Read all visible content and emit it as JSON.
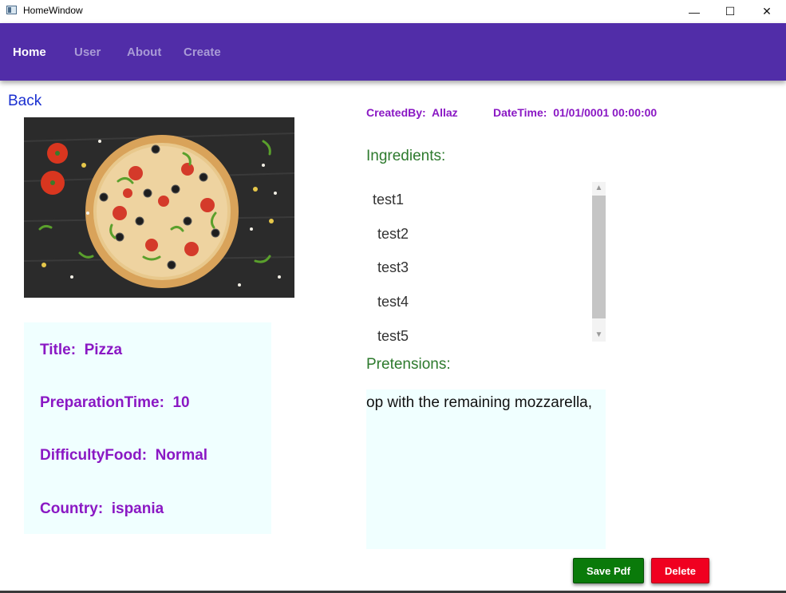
{
  "window": {
    "title": "HomeWindow",
    "minimize": "—",
    "maximize": "☐",
    "close": "✕"
  },
  "nav": {
    "items": [
      {
        "label": "Home"
      },
      {
        "label": "User"
      },
      {
        "label": "About"
      },
      {
        "label": "Create"
      }
    ]
  },
  "back_label": "Back",
  "recipe": {
    "title_label": "Title:",
    "title_value": "Pizza",
    "prep_label": "PreparationTime:",
    "prep_value": "10",
    "difficulty_label": "DifficultyFood:",
    "difficulty_value": "Normal",
    "country_label": "Country:",
    "country_value": "ispania"
  },
  "meta": {
    "created_by_label": "CreatedBy:",
    "created_by_value": "Allaz",
    "datetime_label": "DateTime:",
    "datetime_value": "01/01/0001 00:00:00"
  },
  "ingredients": {
    "label": "Ingredients:",
    "items": [
      "test1",
      "test2",
      "test3",
      "test4",
      "test5"
    ]
  },
  "pretensions": {
    "label": "Pretensions:",
    "text": "op with the remaining mozzarella,"
  },
  "buttons": {
    "save_pdf": "Save Pdf",
    "delete": "Delete"
  },
  "colors": {
    "navbar": "#512da8",
    "accent_text": "#8a18c4",
    "section_label": "#2d7a2d",
    "panel_bg": "#f0ffff",
    "save": "#0a7a0a",
    "delete": "#f00020"
  },
  "icons": {
    "photo": "pizza-photo",
    "scroll_up": "chevron-up-icon",
    "scroll_down": "chevron-down-icon"
  }
}
